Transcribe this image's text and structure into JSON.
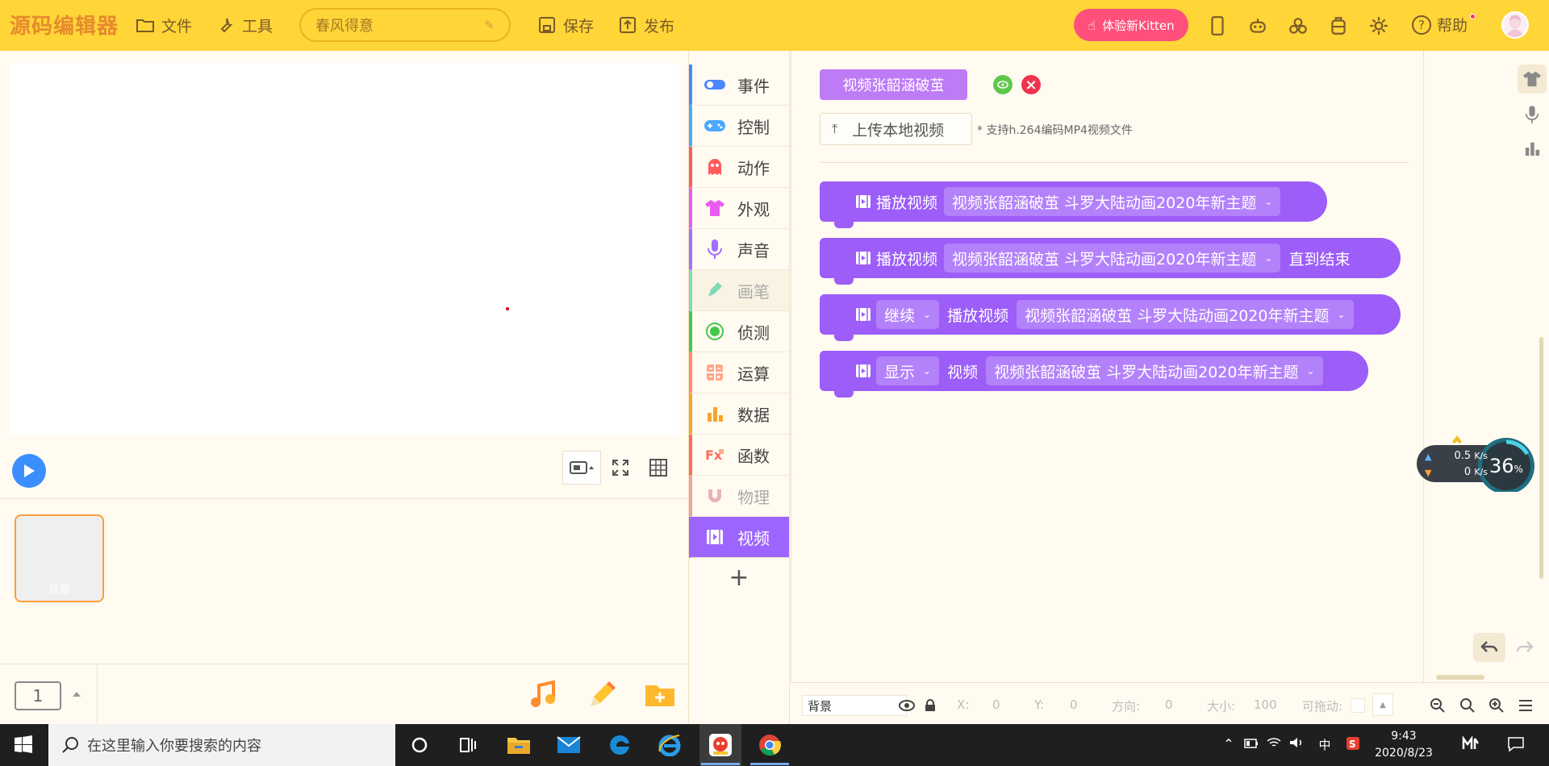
{
  "app": {
    "logo": "源码编辑器"
  },
  "toolbar": {
    "file_label": "文件",
    "tools_label": "工具",
    "title_value": "春风得意",
    "save_label": "保存",
    "publish_label": "发布",
    "kitten_label": "体验新Kitten",
    "help_label": "帮助"
  },
  "sprite": {
    "name": "背景"
  },
  "scene": {
    "number": "1"
  },
  "categories": [
    {
      "label": "事件",
      "color": "#4a86ff",
      "icon": "toggle-icon"
    },
    {
      "label": "控制",
      "color": "#4aa8ff",
      "icon": "gamepad-icon"
    },
    {
      "label": "动作",
      "color": "#ff5b5b",
      "icon": "ghost-icon"
    },
    {
      "label": "外观",
      "color": "#e85cf0",
      "icon": "shirt-icon"
    },
    {
      "label": "声音",
      "color": "#a070ff",
      "icon": "microphone-icon"
    },
    {
      "label": "画笔",
      "color": "#7fd9b6",
      "icon": "pen-icon"
    },
    {
      "label": "侦测",
      "color": "#47c44a",
      "icon": "target-icon"
    },
    {
      "label": "运算",
      "color": "#ff8a6b",
      "icon": "calculator-icon"
    },
    {
      "label": "数据",
      "color": "#f6a42b",
      "icon": "bar-chart-icon"
    },
    {
      "label": "函数",
      "color": "#ff6b5a",
      "icon": "function-icon"
    },
    {
      "label": "物理",
      "color": "#e8a4a4",
      "icon": "magnet-icon"
    },
    {
      "label": "视频",
      "color": "#9c65ff",
      "icon": "film-icon"
    }
  ],
  "workspace": {
    "video_name": "视频张韶涵破茧",
    "upload_label": "上传本地视频",
    "upload_note": "* 支持h.264编码MP4视频文件",
    "blocks": [
      {
        "label": "播放视频",
        "video": "视频张韶涵破茧 斗罗大陆动画2020年新主题"
      },
      {
        "label": "播放视频",
        "video": "视频张韶涵破茧 斗罗大陆动画2020年新主题",
        "suffix": "直到结束"
      },
      {
        "action": "继续",
        "label": "播放视频",
        "video": "视频张韶涵破茧 斗罗大陆动画2020年新主题"
      },
      {
        "action": "显示",
        "label": "视频",
        "video": "视频张韶涵破茧 斗罗大陆动画2020年新主题"
      }
    ]
  },
  "net_widget": {
    "up": "0.5",
    "down": "0",
    "unit": "K/s",
    "percent": "36",
    "percent_sign": "%"
  },
  "statusbar": {
    "name": "背景",
    "x_label": "X:",
    "x_value": "0",
    "y_label": "Y:",
    "y_value": "0",
    "dir_label": "方向:",
    "dir_value": "0",
    "size_label": "大小:",
    "size_value": "100",
    "drag_label": "可拖动:"
  },
  "taskbar": {
    "search_placeholder": "在这里输入你要搜索的内容",
    "time": "9:43",
    "date": "2020/8/23",
    "ime": "中"
  },
  "colors": {
    "topbar": "#ffd537",
    "accent": "#9c65ff",
    "kitten": "#ff4f7a"
  }
}
